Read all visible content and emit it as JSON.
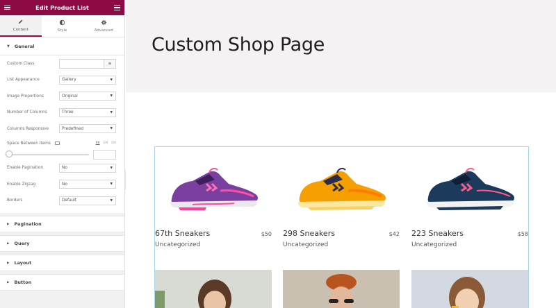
{
  "editor": {
    "title": "Edit Product List",
    "tabs": [
      {
        "label": "Content",
        "icon": "pencil-icon"
      },
      {
        "label": "Style",
        "icon": "half-circle-icon"
      },
      {
        "label": "Advanced",
        "icon": "gear-icon"
      }
    ],
    "general": {
      "heading": "General",
      "custom_class_label": "Custom Class",
      "custom_class_value": "",
      "list_appearance_label": "List Appearance",
      "list_appearance_value": "Gallery",
      "image_proportions_label": "Image Proportions",
      "image_proportions_value": "Original",
      "columns_label": "Number of Columns",
      "columns_value": "Three",
      "columns_responsive_label": "Columns Responsive",
      "columns_responsive_value": "Predefined",
      "space_label": "Space Between Items",
      "units": [
        "PX",
        "EM",
        "EM"
      ],
      "space_level": 0,
      "pagination_label": "Enable Pagination",
      "pagination_value": "No",
      "zigzag_label": "Enable Zigzag",
      "zigzag_value": "No",
      "borders_label": "Borders",
      "borders_value": "Default"
    },
    "sections": [
      "Pagination",
      "Query",
      "Layout",
      "Button"
    ]
  },
  "preview": {
    "page_title": "Custom Shop Page",
    "products": [
      {
        "name": "67th Sneakers",
        "price": "$50",
        "category": "Uncategorized",
        "color": "#7b3fa0"
      },
      {
        "name": "298 Sneakers",
        "price": "$42",
        "category": "Uncategorized",
        "color": "#f5a000"
      },
      {
        "name": "223 Sneakers",
        "price": "$58",
        "category": "Uncategorized",
        "color": "#1c3a5c"
      }
    ]
  },
  "colors": {
    "brand": "#8d0a44",
    "hero_bg": "#f4f2f2",
    "widget_border": "#a9d6ee"
  }
}
